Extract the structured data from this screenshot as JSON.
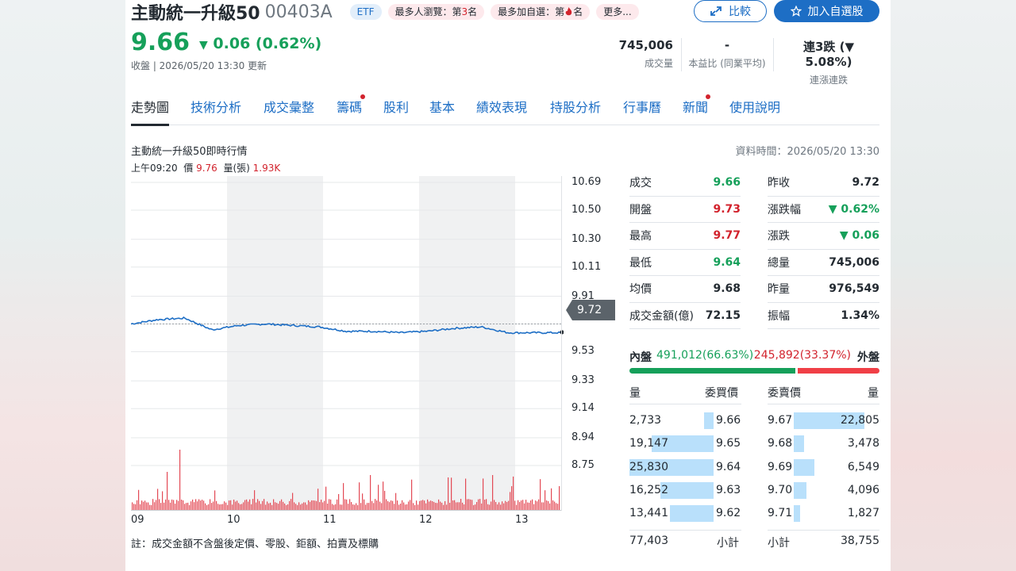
{
  "header": {
    "name": "主動統一升級50",
    "code": "00403A",
    "etf_badge": "ETF",
    "rank_browse_prefix": "最多人瀏覽：第",
    "rank_browse_num": "3",
    "rank_browse_suffix": "名",
    "rank_watch_prefix": "最多加自選：第",
    "rank_watch_suffix": "名",
    "more_label": "更多...",
    "compare_label": "比較",
    "add_label": "加入自選股"
  },
  "price": {
    "last": "9.66",
    "change": "0.06 (0.62%)",
    "status": "收盤 | 2026/05/20 13:30 更新"
  },
  "kpis": [
    {
      "value": "745,006",
      "label": "成交量"
    },
    {
      "value": "-",
      "label": "本益比 (同業平均)"
    },
    {
      "value": "連3跌 (▼ 5.08%)",
      "label": "連漲連跌"
    }
  ],
  "tabs": [
    "走勢圖",
    "技術分析",
    "成交彙整",
    "籌碼",
    "股利",
    "基本",
    "績效表現",
    "持股分析",
    "行事曆",
    "新聞",
    "使用說明"
  ],
  "chart": {
    "title": "主動統一升級50即時行情",
    "data_time": "資料時間：2026/05/20 13:30",
    "info_time": "上午09:20",
    "info_price_label": "價",
    "info_price": "9.76",
    "info_vol_label": "量(張)",
    "info_vol": "1.93K",
    "y_ticks": [
      "10.69",
      "10.50",
      "10.30",
      "10.11",
      "9.91",
      "9.72",
      "9.53",
      "9.33",
      "9.14",
      "8.94",
      "8.75"
    ],
    "x_ticks": [
      "09",
      "10",
      "11",
      "12",
      "13"
    ],
    "ref_price": "9.72",
    "footnote": "註：成交金額不含盤後定價、零股、鉅額、拍賣及標購"
  },
  "chart_data": {
    "type": "line",
    "x": [
      "09:00",
      "09:10",
      "09:20",
      "09:30",
      "09:40",
      "10:00",
      "10:20",
      "10:40",
      "11:00",
      "11:20",
      "11:40",
      "12:00",
      "12:20",
      "12:40",
      "13:00",
      "13:20",
      "13:30"
    ],
    "values": [
      9.72,
      9.75,
      9.76,
      9.68,
      9.71,
      9.72,
      9.71,
      9.7,
      9.67,
      9.67,
      9.66,
      9.67,
      9.69,
      9.7,
      9.66,
      9.66,
      9.66
    ],
    "ylim": [
      8.75,
      10.69
    ],
    "reference": 9.72,
    "series": [
      {
        "name": "價",
        "values": [
          9.72,
          9.75,
          9.76,
          9.68,
          9.71,
          9.72,
          9.71,
          9.7,
          9.67,
          9.67,
          9.66,
          9.67,
          9.69,
          9.7,
          9.66,
          9.66,
          9.66
        ]
      }
    ]
  },
  "quote": [
    {
      "l_label": "成交",
      "l_value": "9.66",
      "l_color": "green",
      "r_label": "昨收",
      "r_value": "9.72",
      "r_color": "dark"
    },
    {
      "l_label": "開盤",
      "l_value": "9.73",
      "l_color": "red",
      "r_label": "漲跌幅",
      "r_value": "▼ 0.62%",
      "r_color": "green"
    },
    {
      "l_label": "最高",
      "l_value": "9.77",
      "l_color": "red",
      "r_label": "漲跌",
      "r_value": "▼ 0.06",
      "r_color": "green"
    },
    {
      "l_label": "最低",
      "l_value": "9.64",
      "l_color": "green",
      "r_label": "總量",
      "r_value": "745,006",
      "r_color": "dark"
    },
    {
      "l_label": "均價",
      "l_value": "9.68",
      "l_color": "dark",
      "r_label": "昨量",
      "r_value": "976,549",
      "r_color": "dark"
    },
    {
      "l_label": "成交金額(億)",
      "l_value": "72.15",
      "l_color": "dark",
      "r_label": "振幅",
      "r_value": "1.34%",
      "r_color": "dark"
    }
  ],
  "inout": {
    "in_label": "內盤",
    "in_value": "491,012(66.63%)",
    "out_value": "245,892(33.37%)",
    "out_label": "外盤",
    "in_pct": 66.63
  },
  "orderbook": {
    "h_vol": "量",
    "h_bid": "委買價",
    "h_ask": "委賣價",
    "h_vol2": "量",
    "rows": [
      {
        "bid_vol": "2,733",
        "bid": "9.66",
        "ask": "9.67",
        "ask_vol": "22,805",
        "bid_frac": 0.11,
        "ask_frac": 0.93
      },
      {
        "bid_vol": "19,147",
        "bid": "9.65",
        "ask": "9.68",
        "ask_vol": "3,478",
        "bid_frac": 0.74,
        "ask_frac": 0.14
      },
      {
        "bid_vol": "25,830",
        "bid": "9.64",
        "ask": "9.69",
        "ask_vol": "6,549",
        "bid_frac": 1.0,
        "ask_frac": 0.27
      },
      {
        "bid_vol": "16,252",
        "bid": "9.63",
        "ask": "9.70",
        "ask_vol": "4,096",
        "bid_frac": 0.63,
        "ask_frac": 0.17
      },
      {
        "bid_vol": "13,441",
        "bid": "9.62",
        "ask": "9.71",
        "ask_vol": "1,827",
        "bid_frac": 0.52,
        "ask_frac": 0.08
      }
    ],
    "bid_total": "77,403",
    "subtotal_label": "小計",
    "ask_total": "38,755"
  }
}
